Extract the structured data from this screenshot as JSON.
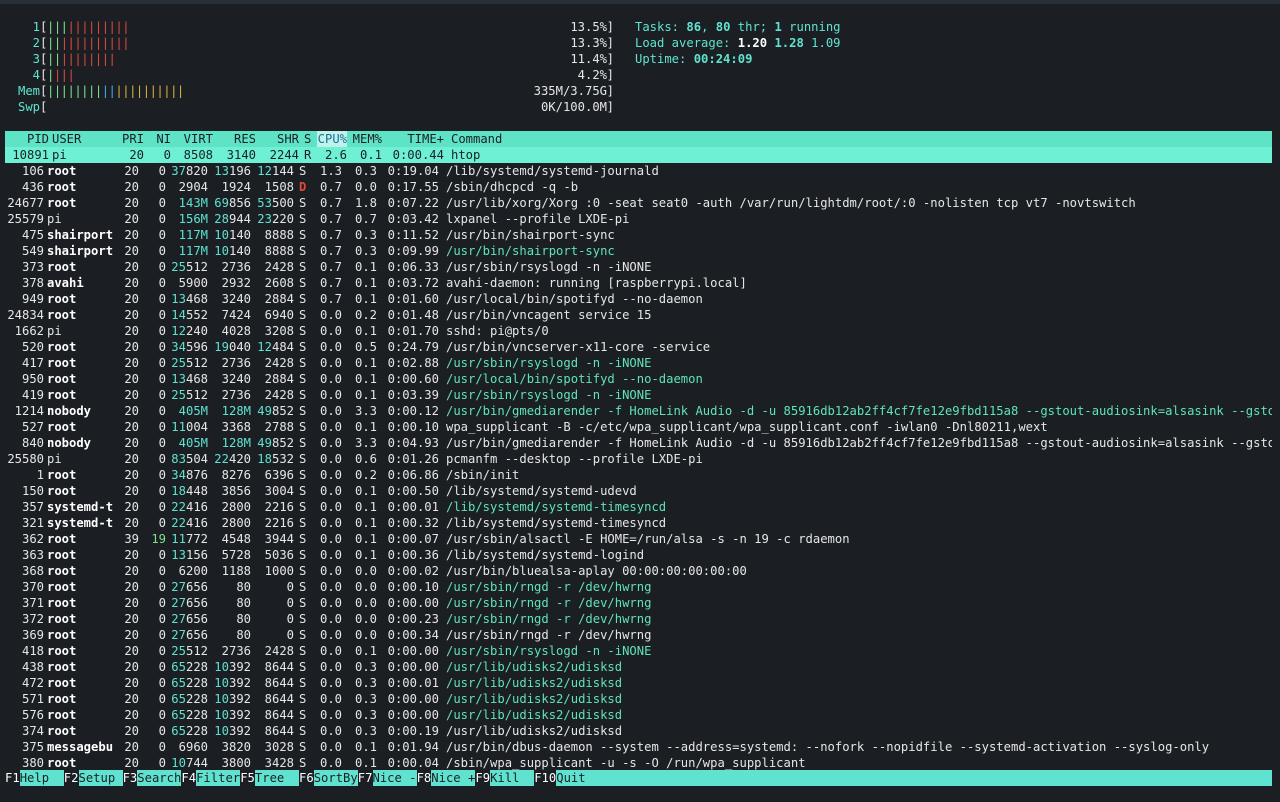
{
  "meters": [
    {
      "label": "1",
      "value": "13.5%",
      "bars": [
        {
          "c": "g",
          "t": "|||"
        },
        {
          "c": "r",
          "t": "|||||||||"
        }
      ]
    },
    {
      "label": "2",
      "value": "13.3%",
      "bars": [
        {
          "c": "g",
          "t": "||"
        },
        {
          "c": "r",
          "t": "||||||||||"
        }
      ]
    },
    {
      "label": "3",
      "value": "11.4%",
      "bars": [
        {
          "c": "g",
          "t": "||"
        },
        {
          "c": "r",
          "t": "||||||||"
        }
      ]
    },
    {
      "label": "4",
      "value": "4.2%",
      "bars": [
        {
          "c": "g",
          "t": "|"
        },
        {
          "c": "r",
          "t": "|||"
        }
      ]
    },
    {
      "label": "Mem",
      "value": "335M/3.75G",
      "bars": [
        {
          "c": "g",
          "t": "||||||||"
        },
        {
          "c": "b",
          "t": "||"
        },
        {
          "c": "y",
          "t": "||||||||||"
        }
      ]
    },
    {
      "label": "Swp",
      "value": "0K/100.0M",
      "bars": []
    }
  ],
  "info": {
    "tasks_label": "Tasks: ",
    "tasks": "86",
    "thr": "80",
    "thr_label": " thr; ",
    "running": "1",
    "running_label": " running",
    "load_label": "Load average: ",
    "load1": "1.20",
    "load5": "1.28",
    "load15": "1.09",
    "uptime_label": "Uptime: ",
    "uptime": "00:24:09"
  },
  "columns": {
    "pid": "PID",
    "user": "USER",
    "pri": "PRI",
    "ni": "NI",
    "virt": "VIRT",
    "res": "RES",
    "shr": "SHR",
    "s": "S",
    "cpu": "CPU%",
    "mem": "MEM%",
    "time": "TIME+",
    "cmd": "Command"
  },
  "processes": [
    [
      "10891",
      "pi",
      "20",
      "0",
      "8508",
      "3140",
      "2244",
      "R",
      "2.6",
      "0.1",
      "0:00.44",
      "htop",
      0
    ],
    [
      "106",
      "root",
      "20",
      "0",
      "37820",
      "13196",
      "12144",
      "S",
      "1.3",
      "0.3",
      "0:19.04",
      "/lib/systemd/systemd-journald",
      0
    ],
    [
      "436",
      "root",
      "20",
      "0",
      "2904",
      "1924",
      "1508",
      "D",
      "0.7",
      "0.0",
      "0:17.55",
      "/sbin/dhcpcd -q -b",
      0
    ],
    [
      "24677",
      "root",
      "20",
      "0",
      "143M",
      "69856",
      "53500",
      "S",
      "0.7",
      "1.8",
      "0:07.22",
      "/usr/lib/xorg/Xorg :0 -seat seat0 -auth /var/run/lightdm/root/:0 -nolisten tcp vt7 -novtswitch",
      0
    ],
    [
      "25579",
      "pi",
      "20",
      "0",
      "156M",
      "28944",
      "23220",
      "S",
      "0.7",
      "0.7",
      "0:03.42",
      "lxpanel --profile LXDE-pi",
      0
    ],
    [
      "475",
      "shairport",
      "20",
      "0",
      "117M",
      "10140",
      "8888",
      "S",
      "0.7",
      "0.3",
      "0:11.52",
      "/usr/bin/shairport-sync",
      0
    ],
    [
      "549",
      "shairport",
      "20",
      "0",
      "117M",
      "10140",
      "8888",
      "S",
      "0.7",
      "0.3",
      "0:09.99",
      "/usr/bin/shairport-sync",
      1
    ],
    [
      "373",
      "root",
      "20",
      "0",
      "25512",
      "2736",
      "2428",
      "S",
      "0.7",
      "0.1",
      "0:06.33",
      "/usr/sbin/rsyslogd -n -iNONE",
      0
    ],
    [
      "378",
      "avahi",
      "20",
      "0",
      "5900",
      "2932",
      "2608",
      "S",
      "0.7",
      "0.1",
      "0:03.72",
      "avahi-daemon: running [raspberrypi.local]",
      0
    ],
    [
      "949",
      "root",
      "20",
      "0",
      "13468",
      "3240",
      "2884",
      "S",
      "0.7",
      "0.1",
      "0:01.60",
      "/usr/local/bin/spotifyd --no-daemon",
      0
    ],
    [
      "24834",
      "root",
      "20",
      "0",
      "14552",
      "7424",
      "6940",
      "S",
      "0.0",
      "0.2",
      "0:01.48",
      "/usr/bin/vncagent service 15",
      0
    ],
    [
      "1662",
      "pi",
      "20",
      "0",
      "12240",
      "4028",
      "3208",
      "S",
      "0.0",
      "0.1",
      "0:01.70",
      "sshd: pi@pts/0",
      0
    ],
    [
      "520",
      "root",
      "20",
      "0",
      "34596",
      "19040",
      "12484",
      "S",
      "0.0",
      "0.5",
      "0:24.79",
      "/usr/bin/vncserver-x11-core -service",
      0
    ],
    [
      "417",
      "root",
      "20",
      "0",
      "25512",
      "2736",
      "2428",
      "S",
      "0.0",
      "0.1",
      "0:02.88",
      "/usr/sbin/rsyslogd -n -iNONE",
      1
    ],
    [
      "950",
      "root",
      "20",
      "0",
      "13468",
      "3240",
      "2884",
      "S",
      "0.0",
      "0.1",
      "0:00.60",
      "/usr/local/bin/spotifyd --no-daemon",
      1
    ],
    [
      "419",
      "root",
      "20",
      "0",
      "25512",
      "2736",
      "2428",
      "S",
      "0.0",
      "0.1",
      "0:03.39",
      "/usr/sbin/rsyslogd -n -iNONE",
      1
    ],
    [
      "1214",
      "nobody",
      "20",
      "0",
      "405M",
      "128M",
      "49852",
      "S",
      "0.0",
      "3.3",
      "0:00.12",
      "/usr/bin/gmediarender -f HomeLink Audio -d -u 85916db12ab2ff4cf7fe12e9fbd115a8 --gstout-audiosink=alsasink --gstout-au",
      1
    ],
    [
      "527",
      "root",
      "20",
      "0",
      "11004",
      "3368",
      "2788",
      "S",
      "0.0",
      "0.1",
      "0:00.10",
      "wpa_supplicant -B -c/etc/wpa_supplicant/wpa_supplicant.conf -iwlan0 -Dnl80211,wext",
      0
    ],
    [
      "840",
      "nobody",
      "20",
      "0",
      "405M",
      "128M",
      "49852",
      "S",
      "0.0",
      "3.3",
      "0:04.93",
      "/usr/bin/gmediarender -f HomeLink Audio -d -u 85916db12ab2ff4cf7fe12e9fbd115a8 --gstout-audiosink=alsasink --gstout-au",
      0
    ],
    [
      "25580",
      "pi",
      "20",
      "0",
      "83504",
      "22420",
      "18532",
      "S",
      "0.0",
      "0.6",
      "0:01.26",
      "pcmanfm --desktop --profile LXDE-pi",
      0
    ],
    [
      "1",
      "root",
      "20",
      "0",
      "34876",
      "8276",
      "6396",
      "S",
      "0.0",
      "0.2",
      "0:06.86",
      "/sbin/init",
      0
    ],
    [
      "150",
      "root",
      "20",
      "0",
      "18448",
      "3856",
      "3004",
      "S",
      "0.0",
      "0.1",
      "0:00.50",
      "/lib/systemd/systemd-udevd",
      0
    ],
    [
      "357",
      "systemd-t",
      "20",
      "0",
      "22416",
      "2800",
      "2216",
      "S",
      "0.0",
      "0.1",
      "0:00.01",
      "/lib/systemd/systemd-timesyncd",
      1
    ],
    [
      "321",
      "systemd-t",
      "20",
      "0",
      "22416",
      "2800",
      "2216",
      "S",
      "0.0",
      "0.1",
      "0:00.32",
      "/lib/systemd/systemd-timesyncd",
      0
    ],
    [
      "362",
      "root",
      "39",
      "19",
      "11772",
      "4548",
      "3944",
      "S",
      "0.0",
      "0.1",
      "0:00.07",
      "/usr/sbin/alsactl -E HOME=/run/alsa -s -n 19 -c rdaemon",
      0
    ],
    [
      "363",
      "root",
      "20",
      "0",
      "13156",
      "5728",
      "5036",
      "S",
      "0.0",
      "0.1",
      "0:00.36",
      "/lib/systemd/systemd-logind",
      0
    ],
    [
      "368",
      "root",
      "20",
      "0",
      "6200",
      "1188",
      "1000",
      "S",
      "0.0",
      "0.0",
      "0:00.02",
      "/usr/bin/bluealsa-aplay 00:00:00:00:00:00",
      0
    ],
    [
      "370",
      "root",
      "20",
      "0",
      "27656",
      "80",
      "0",
      "S",
      "0.0",
      "0.0",
      "0:00.10",
      "/usr/sbin/rngd -r /dev/hwrng",
      1
    ],
    [
      "371",
      "root",
      "20",
      "0",
      "27656",
      "80",
      "0",
      "S",
      "0.0",
      "0.0",
      "0:00.00",
      "/usr/sbin/rngd -r /dev/hwrng",
      1
    ],
    [
      "372",
      "root",
      "20",
      "0",
      "27656",
      "80",
      "0",
      "S",
      "0.0",
      "0.0",
      "0:00.23",
      "/usr/sbin/rngd -r /dev/hwrng",
      1
    ],
    [
      "369",
      "root",
      "20",
      "0",
      "27656",
      "80",
      "0",
      "S",
      "0.0",
      "0.0",
      "0:00.34",
      "/usr/sbin/rngd -r /dev/hwrng",
      0
    ],
    [
      "418",
      "root",
      "20",
      "0",
      "25512",
      "2736",
      "2428",
      "S",
      "0.0",
      "0.1",
      "0:00.00",
      "/usr/sbin/rsyslogd -n -iNONE",
      1
    ],
    [
      "438",
      "root",
      "20",
      "0",
      "65228",
      "10392",
      "8644",
      "S",
      "0.0",
      "0.3",
      "0:00.00",
      "/usr/lib/udisks2/udisksd",
      1
    ],
    [
      "472",
      "root",
      "20",
      "0",
      "65228",
      "10392",
      "8644",
      "S",
      "0.0",
      "0.3",
      "0:00.01",
      "/usr/lib/udisks2/udisksd",
      1
    ],
    [
      "571",
      "root",
      "20",
      "0",
      "65228",
      "10392",
      "8644",
      "S",
      "0.0",
      "0.3",
      "0:00.00",
      "/usr/lib/udisks2/udisksd",
      1
    ],
    [
      "576",
      "root",
      "20",
      "0",
      "65228",
      "10392",
      "8644",
      "S",
      "0.0",
      "0.3",
      "0:00.00",
      "/usr/lib/udisks2/udisksd",
      1
    ],
    [
      "374",
      "root",
      "20",
      "0",
      "65228",
      "10392",
      "8644",
      "S",
      "0.0",
      "0.3",
      "0:00.19",
      "/usr/lib/udisks2/udisksd",
      0
    ],
    [
      "375",
      "messagebu",
      "20",
      "0",
      "6960",
      "3820",
      "3028",
      "S",
      "0.0",
      "0.1",
      "0:01.94",
      "/usr/bin/dbus-daemon --system --address=systemd: --nofork --nopidfile --systemd-activation --syslog-only",
      0
    ],
    [
      "380",
      "root",
      "20",
      "0",
      "10744",
      "3800",
      "3428",
      "S",
      "0.0",
      "0.1",
      "0:00.04",
      "/sbin/wpa_supplicant -u -s -O /run/wpa_supplicant",
      0
    ]
  ],
  "footer": [
    {
      "key": "F1",
      "label": "Help  "
    },
    {
      "key": "F2",
      "label": "Setup "
    },
    {
      "key": "F3",
      "label": "Search"
    },
    {
      "key": "F4",
      "label": "Filter"
    },
    {
      "key": "F5",
      "label": "Tree  "
    },
    {
      "key": "F6",
      "label": "SortBy"
    },
    {
      "key": "F7",
      "label": "Nice -"
    },
    {
      "key": "F8",
      "label": "Nice +"
    },
    {
      "key": "F9",
      "label": "Kill  "
    },
    {
      "key": "F10",
      "label": "Quit"
    }
  ],
  "colors": {
    "accent": "#5fe3d0",
    "background": "#1b1f24",
    "bar_green": "#7ee08a",
    "bar_red": "#e0483e",
    "bar_blue": "#4aa8f0",
    "bar_yellow": "#d8b43a"
  }
}
